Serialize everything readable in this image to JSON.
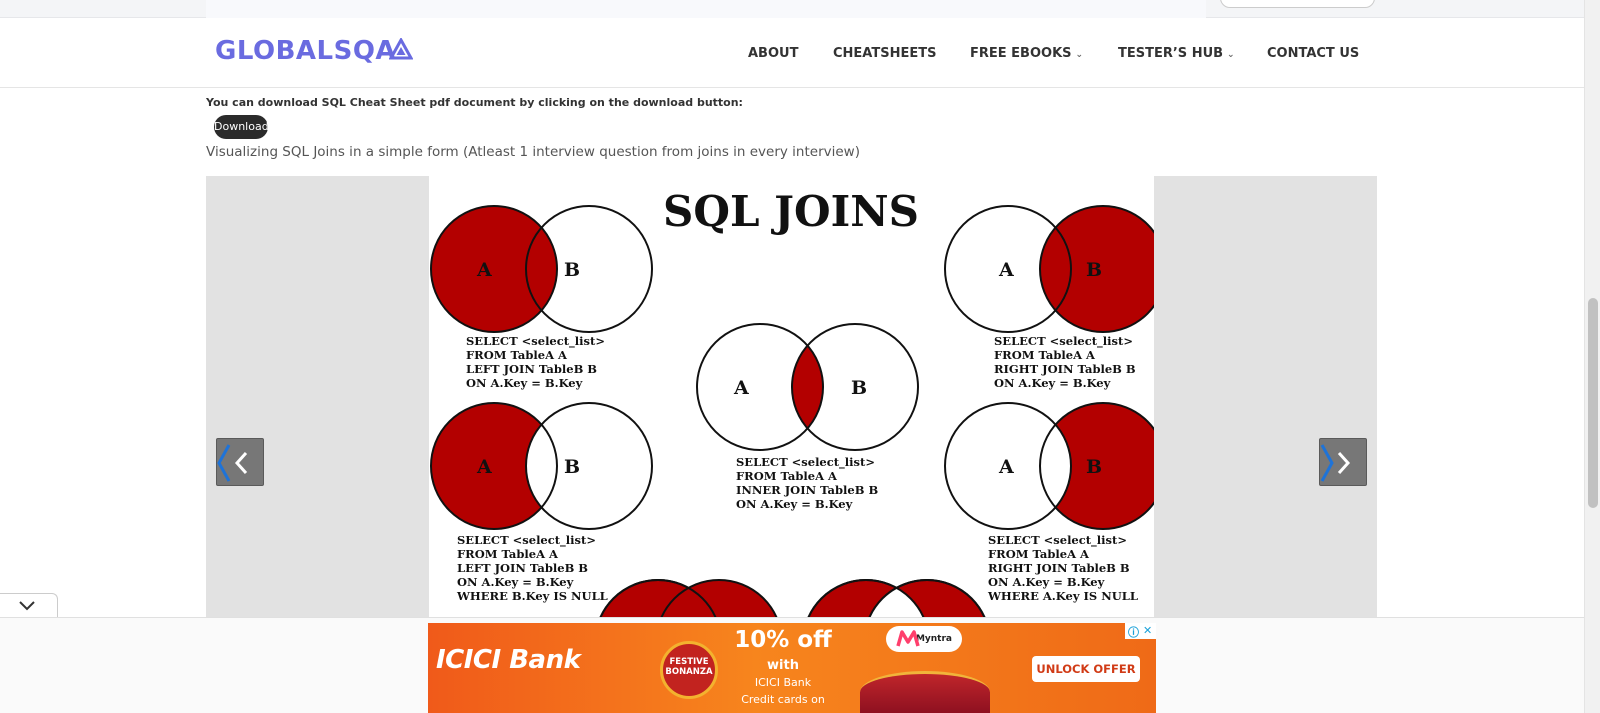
{
  "header": {
    "logo": "GLOBALSQA",
    "nav": [
      {
        "label": "ABOUT"
      },
      {
        "label": "CHEATSHEETS"
      },
      {
        "label": "FREE EBOOKS",
        "chevron": "⌄"
      },
      {
        "label": "TESTER’S HUB",
        "chevron": "⌄"
      },
      {
        "label": "CONTACT US"
      }
    ]
  },
  "content": {
    "download_text": "You can download SQL Cheat Sheet pdf document by clicking on the download button:",
    "download_label": "Download",
    "visualizing_text": "Visualizing SQL Joins in a simple form (Atleast 1 interview question from joins in every interview)"
  },
  "slider": {
    "title": "SQL JOINS",
    "fill_color": "#b30000",
    "diagrams": {
      "left_join": {
        "a": "A",
        "b": "B",
        "lines": [
          "SELECT <select_list>",
          "FROM TableA A",
          "LEFT JOIN TableB B",
          "ON A.Key = B.Key"
        ]
      },
      "right_join": {
        "a": "A",
        "b": "B",
        "lines": [
          "SELECT <select_list>",
          "FROM TableA A",
          "RIGHT JOIN TableB B",
          "ON A.Key = B.Key"
        ]
      },
      "inner_join": {
        "a": "A",
        "b": "B",
        "lines": [
          "SELECT <select_list>",
          "FROM TableA A",
          "INNER JOIN TableB B",
          "ON A.Key = B.Key"
        ]
      },
      "left_only": {
        "a": "A",
        "b": "B",
        "lines": [
          "SELECT <select_list>",
          "FROM TableA A",
          "LEFT JOIN TableB B",
          "ON A.Key = B.Key",
          "WHERE B.Key IS NULL"
        ]
      },
      "right_only": {
        "a": "A",
        "b": "B",
        "lines": [
          "SELECT <select_list>",
          "FROM TableA A",
          "RIGHT JOIN TableB B",
          "ON A.Key = B.Key",
          "WHERE A.Key IS NULL"
        ]
      }
    }
  },
  "ad": {
    "brand": "ICICI Bank",
    "bonanza": "FESTIVE BONANZA",
    "offer": "10% off",
    "with": "with",
    "bank": "ICICI Bank",
    "cards": "Credit cards on",
    "partner": "Myntra",
    "cta": "UNLOCK OFFER",
    "info_icon": "ⓘ",
    "close_icon": "✕"
  }
}
